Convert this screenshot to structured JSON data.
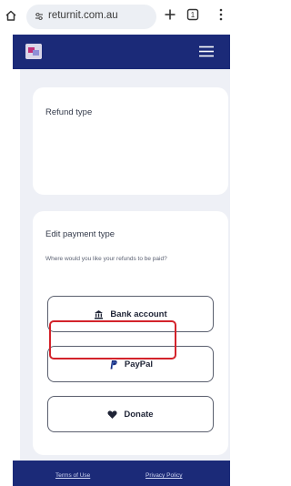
{
  "browser": {
    "url": "returnit.com.au",
    "icons": [
      "home-icon",
      "site-settings-icon",
      "new-tab-plus-icon",
      "tabs-count-icon",
      "more-menu-icon"
    ],
    "tabs_count": "1"
  },
  "header": {
    "logo_icon": "returnit-logo-icon",
    "menu_icon": "hamburger-menu-icon",
    "color": "#1b2a78"
  },
  "refund_card": {
    "title": "Refund type"
  },
  "edit_card": {
    "title": "Edit payment type",
    "subtitle": "Where would you like your refunds to be paid?",
    "options": [
      {
        "label": "Bank account",
        "icon": "bank-icon"
      },
      {
        "label": "PayPal",
        "icon": "paypal-icon"
      },
      {
        "label": "Donate",
        "icon": "heart-icon"
      }
    ]
  },
  "footer": {
    "terms": "Terms of Use",
    "privacy": "Privacy Policy"
  },
  "colors": {
    "brand": "#1b2a78",
    "background": "#eef0f6",
    "highlight": "#d3232b"
  }
}
